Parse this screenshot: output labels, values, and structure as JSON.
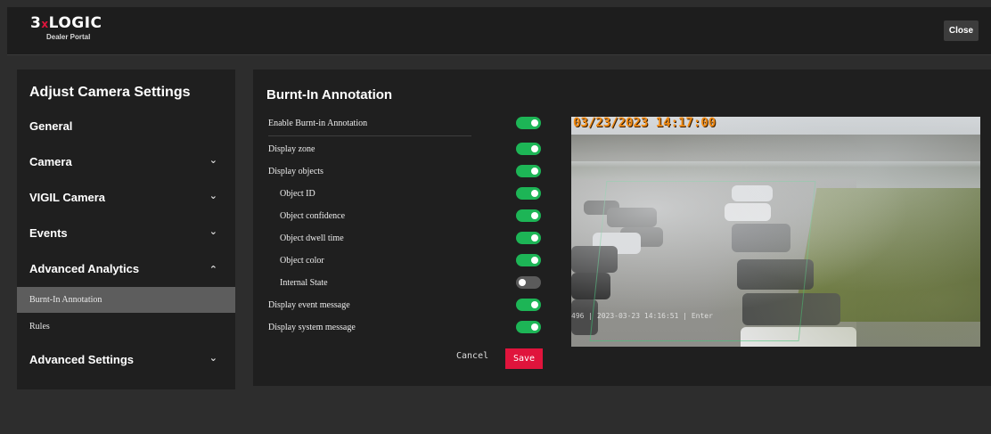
{
  "brand": {
    "logo_main": "3",
    "logo_x": "x",
    "logo_rest": "LOGIC",
    "logo_sub": "Dealer Portal"
  },
  "header": {
    "close_label": "Close"
  },
  "sidebar": {
    "title": "Adjust Camera Settings",
    "items": [
      {
        "label": "General"
      },
      {
        "label": "Camera",
        "chevron": "chevron-down-icon"
      },
      {
        "label": "VIGIL Camera",
        "chevron": "chevron-down-icon"
      },
      {
        "label": "Events",
        "chevron": "chevron-down-icon"
      },
      {
        "label": "Advanced Analytics",
        "chevron": "chevron-up-icon"
      },
      {
        "label": "Advanced Settings",
        "chevron": "chevron-down-icon"
      }
    ],
    "sub_items": [
      {
        "label": "Burnt-In Annotation",
        "active": true
      },
      {
        "label": "Rules",
        "active": false
      }
    ]
  },
  "panel": {
    "title": "Burnt-In Annotation",
    "options": [
      {
        "label": "Enable Burnt-in Annotation",
        "enabled": true
      },
      {
        "label": "Display zone",
        "enabled": true
      },
      {
        "label": "Display objects",
        "enabled": true
      },
      {
        "label": "Object ID",
        "enabled": true
      },
      {
        "label": "Object confidence",
        "enabled": true
      },
      {
        "label": "Object dwell time",
        "enabled": true
      },
      {
        "label": "Object color",
        "enabled": true
      },
      {
        "label": "Internal State",
        "enabled": false
      },
      {
        "label": "Display event message",
        "enabled": true
      },
      {
        "label": "Display system message",
        "enabled": true
      }
    ],
    "cancel_label": "Cancel",
    "save_label": "Save"
  },
  "preview": {
    "timestamp": "03/23/2023 14:17:00",
    "message": "496 | 2023-03-23 14:16:51 | Enter"
  },
  "colors": {
    "accent": "#e0143c",
    "toggle_on": "#1db556",
    "toggle_off": "#5b5b5b",
    "timestamp": "#f08a12"
  }
}
